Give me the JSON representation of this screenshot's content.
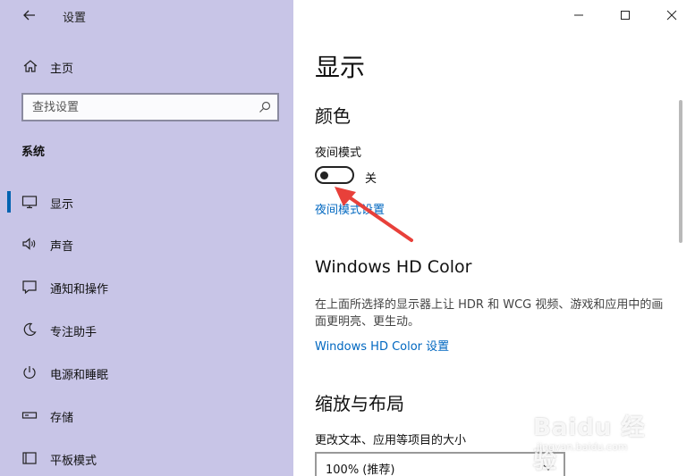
{
  "app": {
    "title": "设置"
  },
  "sidebar": {
    "home_label": "主页",
    "search": {
      "placeholder": "查找设置"
    },
    "section_label": "系统",
    "items": [
      {
        "label": "显示",
        "icon": "monitor-icon",
        "active": true
      },
      {
        "label": "声音",
        "icon": "speaker-icon",
        "active": false
      },
      {
        "label": "通知和操作",
        "icon": "message-icon",
        "active": false
      },
      {
        "label": "专注助手",
        "icon": "moon-icon",
        "active": false
      },
      {
        "label": "电源和睡眠",
        "icon": "power-icon",
        "active": false
      },
      {
        "label": "存储",
        "icon": "storage-icon",
        "active": false
      },
      {
        "label": "平板模式",
        "icon": "tablet-icon",
        "active": false
      }
    ]
  },
  "main": {
    "page_title": "显示",
    "color_section": {
      "heading": "颜色",
      "night_mode_label": "夜间模式",
      "toggle_state": "关",
      "night_mode_settings_link": "夜间模式设置"
    },
    "hd_section": {
      "heading": "Windows HD Color",
      "description": "在上面所选择的显示器上让 HDR 和 WCG 视频、游戏和应用中的画面更明亮、更生动。",
      "settings_link": "Windows HD Color 设置"
    },
    "scale_section": {
      "heading": "缩放与布局",
      "size_label": "更改文本、应用等项目的大小",
      "dropdown_value": "100% (推荐)"
    }
  },
  "colors": {
    "sidebar_bg": "#c8c5e7",
    "accent": "#0063b1",
    "link": "#0067c0",
    "annotation_red": "#e8403a"
  },
  "watermark": {
    "text": "Baidu 经验",
    "subtext": "jingyan.baidu.com"
  }
}
